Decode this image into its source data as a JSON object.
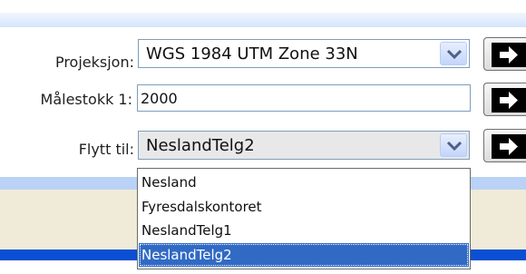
{
  "form": {
    "projection": {
      "label": "Projeksjon:",
      "value": "WGS 1984 UTM Zone 33N"
    },
    "scale": {
      "label": "Målestokk 1:",
      "value": "2000"
    },
    "move_to": {
      "label": "Flytt til:",
      "value": "NeslandTelg2",
      "options": [
        "Nesland",
        "Fyresdalskontoret",
        "NeslandTelg1",
        "NeslandTelg2"
      ],
      "selected_index": 3
    }
  },
  "colors": {
    "select_border": "#7f9db9",
    "selection_highlight": "#316ac5",
    "panel_band": "#b9d2f5",
    "footer_beige": "#efebd8",
    "bottom_bar": "#0b4fd3"
  },
  "icons": {
    "dropdown": "chevron-down-icon",
    "go": "arrow-right-icon"
  }
}
